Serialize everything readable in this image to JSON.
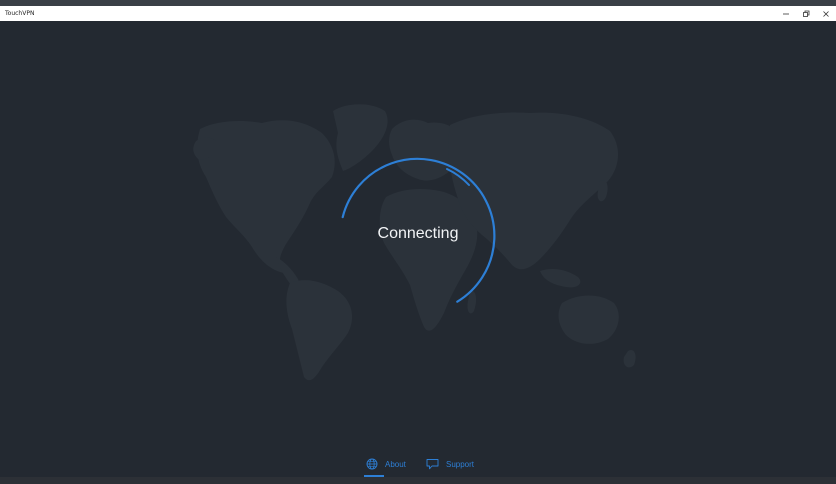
{
  "window": {
    "title": "TouchVPN",
    "controls": {
      "minimize": "minimize-icon",
      "maximize": "restore-icon",
      "close": "close-icon"
    }
  },
  "main": {
    "status_text": "Connecting",
    "progress_ring": {
      "color": "#2d7fd6",
      "track_color": "#1e2329"
    },
    "map_color": "#2b323a"
  },
  "nav": {
    "about_label": "About",
    "about_icon": "globe-icon",
    "support_label": "Support",
    "support_icon": "chat-bubble-icon",
    "active": "about",
    "accent": "#2d7fd6"
  },
  "colors": {
    "background": "#232931",
    "text": "#f2f4f6"
  }
}
